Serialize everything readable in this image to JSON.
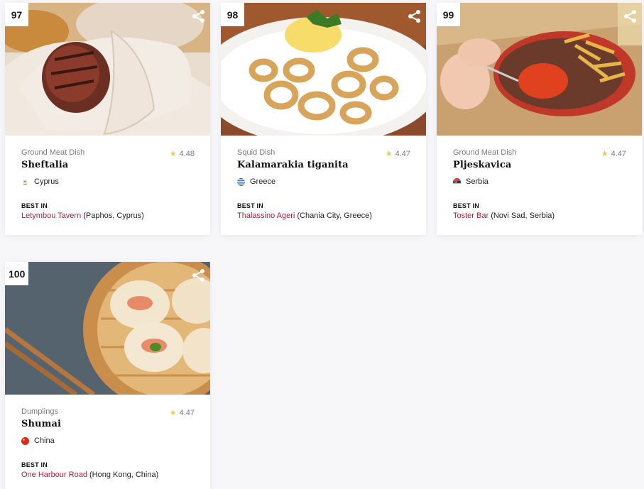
{
  "cards": [
    {
      "rank": "97",
      "category": "Ground Meat Dish",
      "rating": "4.48",
      "name": "Sheftalia",
      "country": "Cyprus",
      "best_in_label": "BEST IN",
      "restaurant": "Letymbou Tavern",
      "location": "(Paphos, Cyprus)",
      "image_alt": "sheftalia wrapped in pita"
    },
    {
      "rank": "98",
      "category": "Squid Dish",
      "rating": "4.47",
      "name": "Kalamarakia tiganita",
      "country": "Greece",
      "best_in_label": "BEST IN",
      "restaurant": "Thalassino Ageri",
      "location": "(Chania City, Greece)",
      "image_alt": "fried calamari rings with lemon"
    },
    {
      "rank": "99",
      "category": "Ground Meat Dish",
      "rating": "4.47",
      "name": "Pljeskavica",
      "country": "Serbia",
      "best_in_label": "BEST IN",
      "restaurant": "Toster Bar",
      "location": "(Novi Sad, Serbia)",
      "image_alt": "pljeskavica with fries and ajvar"
    },
    {
      "rank": "100",
      "category": "Dumplings",
      "rating": "4.47",
      "name": "Shumai",
      "country": "China",
      "best_in_label": "BEST IN",
      "restaurant": "One Harbour Road",
      "location": "(Hong Kong, China)",
      "image_alt": "shumai dumplings in bamboo steamer"
    }
  ],
  "icons": {
    "share": "share-icon",
    "star": "star-icon"
  },
  "colors": {
    "link": "#b2203c",
    "star": "#f3c84b",
    "background": "#f7f7f9"
  }
}
